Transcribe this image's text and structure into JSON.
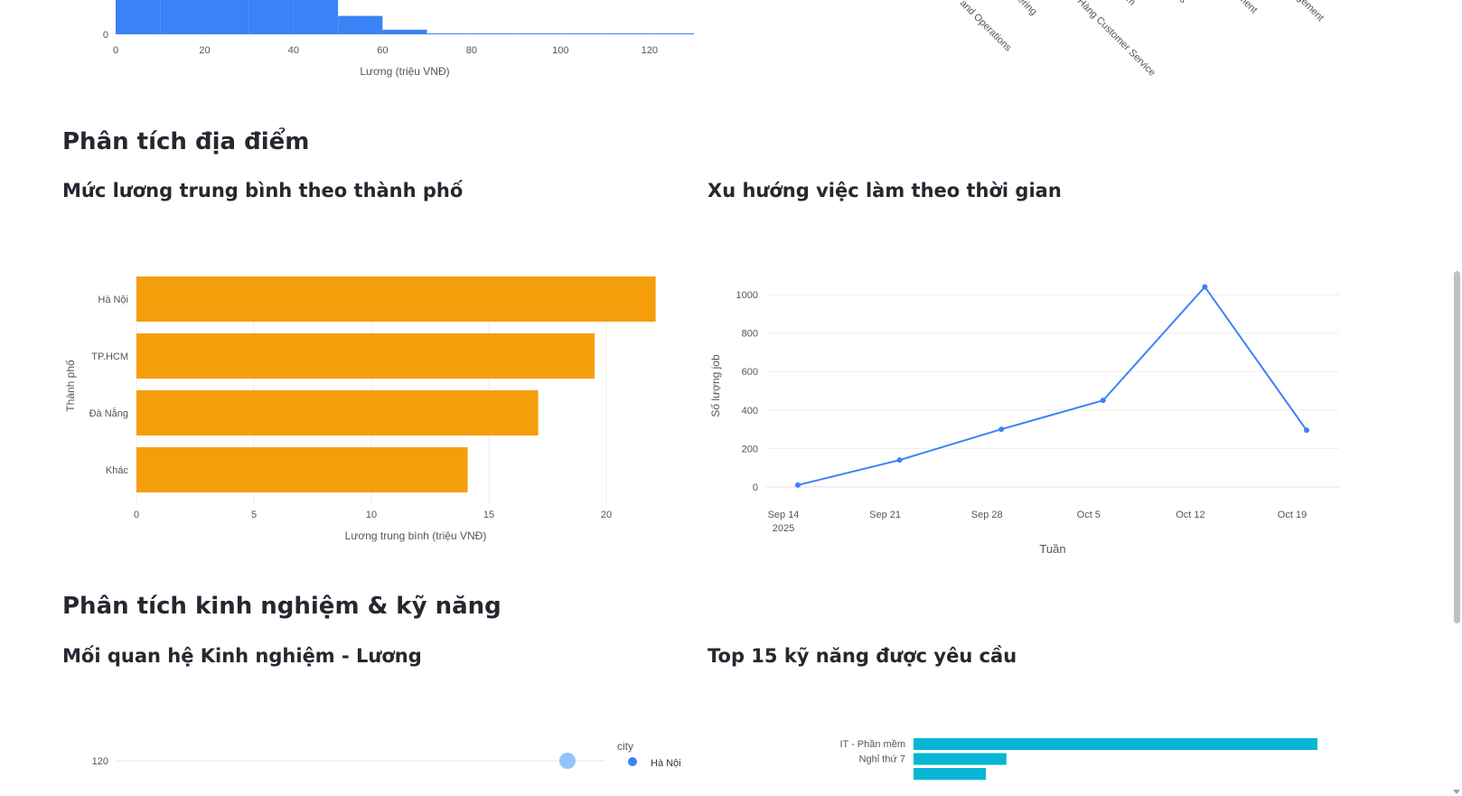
{
  "sections": {
    "location": "Phân tích địa điểm",
    "experience_skills": "Phân tích kinh nghiệm & kỹ năng"
  },
  "charts": {
    "salary_hist": {
      "xlabel": "Lương (triệu VNĐ)",
      "ytick0": "0",
      "xticks": [
        "0",
        "20",
        "40",
        "60",
        "80",
        "100",
        "120"
      ]
    },
    "industry_labels_fragment": [
      "and Operations",
      "ering",
      "Hàng Customer Service",
      "m",
      "s",
      "ment",
      "gement"
    ],
    "city_salary": {
      "title": "Mức lương trung bình theo thành phố",
      "xlabel": "Lương trung bình (triệu VNĐ)",
      "ylabel": "Thành phố",
      "xticks": [
        "0",
        "5",
        "10",
        "15",
        "20"
      ]
    },
    "trend": {
      "title": "Xu hướng việc làm theo thời gian",
      "xlabel": "Tuần",
      "ylabel": "Số lượng job",
      "yticks": [
        "0",
        "200",
        "400",
        "600",
        "800",
        "1000"
      ],
      "xticks": [
        "Sep 14",
        "Sep 21",
        "Sep 28",
        "Oct 5",
        "Oct 12",
        "Oct 19"
      ],
      "year_label": "2025"
    },
    "exp_salary": {
      "title": "Mối quan hệ Kinh nghiệm - Lương",
      "ytick": "120",
      "legend_title": "city",
      "legend_item": "Hà Nội"
    },
    "skills": {
      "title": "Top 15 kỹ năng được yêu cầu",
      "labels": [
        "IT - Phần mềm",
        "Nghỉ thứ 7"
      ]
    }
  },
  "colors": {
    "hist_bar": "#3b82f6",
    "city_bar": "#f59e0b",
    "trend_line": "#3b82f6",
    "skill_bar": "#06b6d4",
    "scatter_point": "#93c5fd"
  },
  "chart_data": [
    {
      "type": "bar",
      "bin_edges": [
        0,
        10,
        20,
        30,
        40,
        50,
        60,
        70,
        80,
        90,
        100,
        110,
        120,
        130
      ],
      "values": [
        null,
        null,
        null,
        null,
        23,
        12,
        3,
        0.3,
        0.5,
        0.2,
        0,
        0,
        0.2
      ],
      "xlabel": "Lương (triệu VNĐ)",
      "xlim": [
        0,
        130
      ]
    },
    {
      "type": "bar",
      "orientation": "horizontal",
      "categories": [
        "Hà Nội",
        "TP.HCM",
        "Đà Nẵng",
        "Khác"
      ],
      "values": [
        22.1,
        19.5,
        17.1,
        14.1
      ],
      "title": "Mức lương trung bình theo thành phố",
      "xlabel": "Lương trung bình (triệu VNĐ)",
      "ylabel": "Thành phố",
      "xlim": [
        0,
        22.5
      ]
    },
    {
      "type": "line",
      "x": [
        "2025-09-14",
        "2025-09-21",
        "2025-09-28",
        "2025-10-05",
        "2025-10-12",
        "2025-10-19"
      ],
      "y": [
        10,
        140,
        300,
        450,
        1040,
        295
      ],
      "title": "Xu hướng việc làm theo thời gian",
      "xlabel": "Tuần",
      "ylabel": "Số lượng job",
      "ylim": [
        0,
        1000
      ]
    },
    {
      "type": "bar",
      "orientation": "horizontal",
      "categories": [
        "IT - Phần mềm",
        "Nghỉ thứ 7"
      ],
      "values": [
        1,
        0.23
      ],
      "title": "Top 15 kỹ năng được yêu cầu"
    }
  ]
}
